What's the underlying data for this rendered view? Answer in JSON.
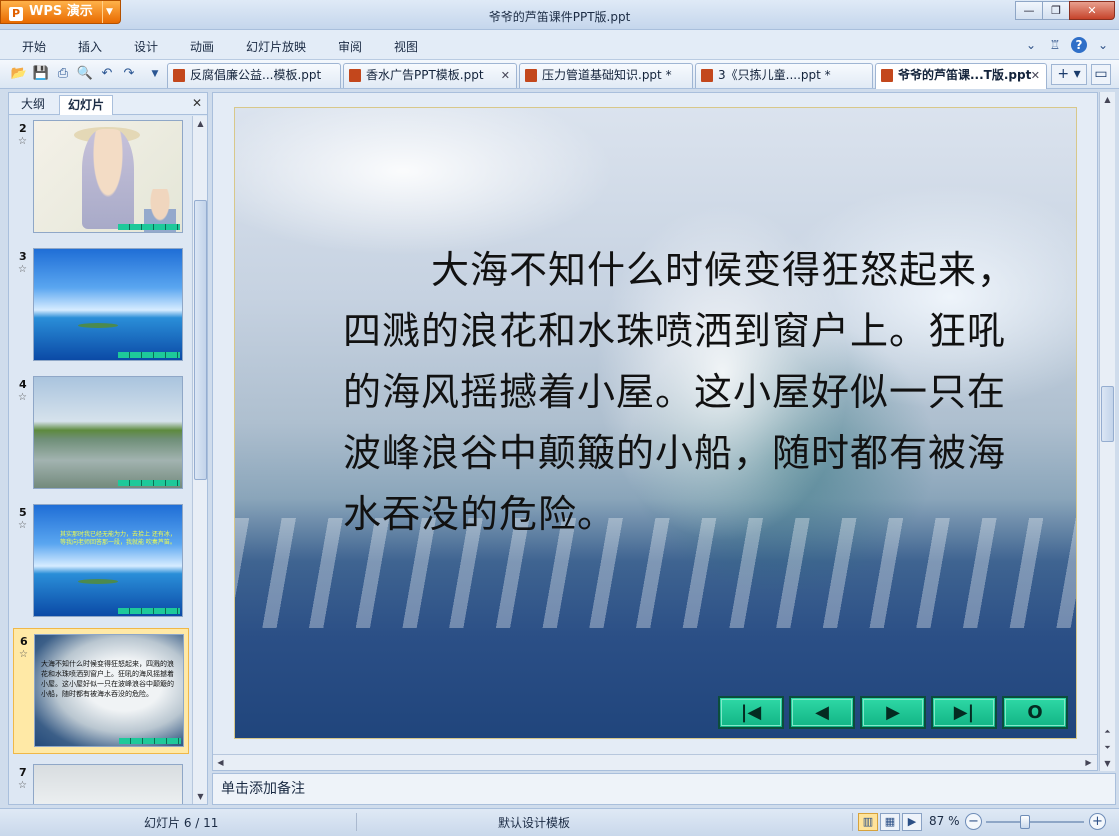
{
  "app": {
    "name": "WPS 演示",
    "window_title": "爷爷的芦笛课件PPT版.ppt"
  },
  "menu": [
    "开始",
    "插入",
    "设计",
    "动画",
    "幻灯片放映",
    "审阅",
    "视图"
  ],
  "doc_tabs": [
    {
      "label": "反腐倡廉公益...模板.ppt",
      "active": false
    },
    {
      "label": "香水广告PPT模板.ppt",
      "active": false
    },
    {
      "label": "压力管道基础知识.ppt *",
      "active": false
    },
    {
      "label": "3《只拣儿童....ppt *",
      "active": false
    },
    {
      "label": "爷爷的芦笛课...T版.ppt",
      "active": true
    }
  ],
  "left_panel": {
    "tabs": [
      "大纲",
      "幻灯片"
    ],
    "active_tab": "幻灯片",
    "thumbnails": [
      {
        "num": "2"
      },
      {
        "num": "3"
      },
      {
        "num": "4"
      },
      {
        "num": "5",
        "caption": "其实那时我已经无能为力，去拾上 还有冰，等我向老师回答那一段，我就能 吹奏芦笛。"
      },
      {
        "num": "6",
        "caption": "大海不知什么时候变得狂怒起来，四溅的浪花和水珠喷洒到窗户上。狂吼的海风摇撼着小屋。这小屋好似一只在波峰浪谷中颠簸的小船，随时都有被海水吞没的危险。",
        "selected": true
      },
      {
        "num": "7"
      }
    ]
  },
  "slide": {
    "text": "大海不知什么时候变得狂怒起来，四溅的浪花和水珠喷洒到窗户上。狂吼的海风摇撼着小屋。这小屋好似一只在波峰浪谷中颠簸的小船，随时都有被海水吞没的危险。",
    "nav_buttons": [
      {
        "name": "first-slide-button",
        "glyph": "|◀"
      },
      {
        "name": "prev-slide-button",
        "glyph": "◀"
      },
      {
        "name": "next-slide-button",
        "glyph": "▶"
      },
      {
        "name": "last-slide-button",
        "glyph": "▶|"
      },
      {
        "name": "end-show-button",
        "glyph": "O"
      }
    ]
  },
  "notes_placeholder": "单击添加备注",
  "status": {
    "slide_counter": "幻灯片 6 / 11",
    "template": "默认设计模板",
    "zoom": "87 %"
  }
}
